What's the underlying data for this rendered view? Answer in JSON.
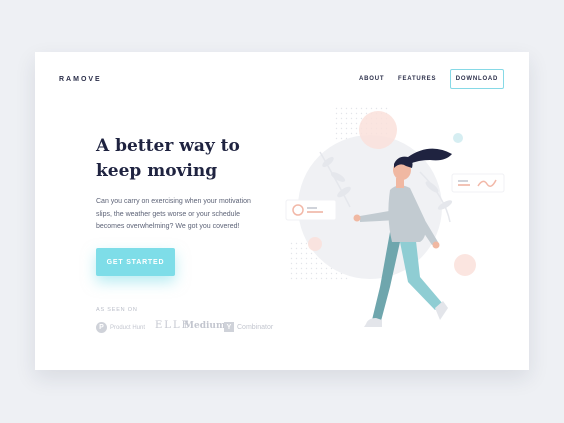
{
  "brand": {
    "logo": "RAMOVE"
  },
  "nav": {
    "about": "ABOUT",
    "features": "FEATURES",
    "download": "DOWNLOAD"
  },
  "hero": {
    "headline_line1": "A better way to",
    "headline_line2": "keep moving",
    "body": "Can you carry on exercising when your motivation slips, the weather gets worse or your schedule becomes overwhelming? We got you covered!",
    "cta": "GET STARTED"
  },
  "as_seen_on": {
    "label": "AS SEEN ON",
    "brands": {
      "product_hunt_icon": "P",
      "product_hunt": "Product Hunt",
      "elle": "ELLE",
      "medium": "Medium",
      "ycombinator_icon": "Y",
      "ycombinator": "Combinator"
    }
  },
  "colors": {
    "accent": "#7edde8",
    "dark": "#1f2340",
    "text": "#5d6377",
    "muted": "#c3c6cf",
    "peach": "#f8d9d2"
  },
  "icons": [
    "product-hunt-icon",
    "ycombinator-icon",
    "walking-woman-illustration"
  ]
}
